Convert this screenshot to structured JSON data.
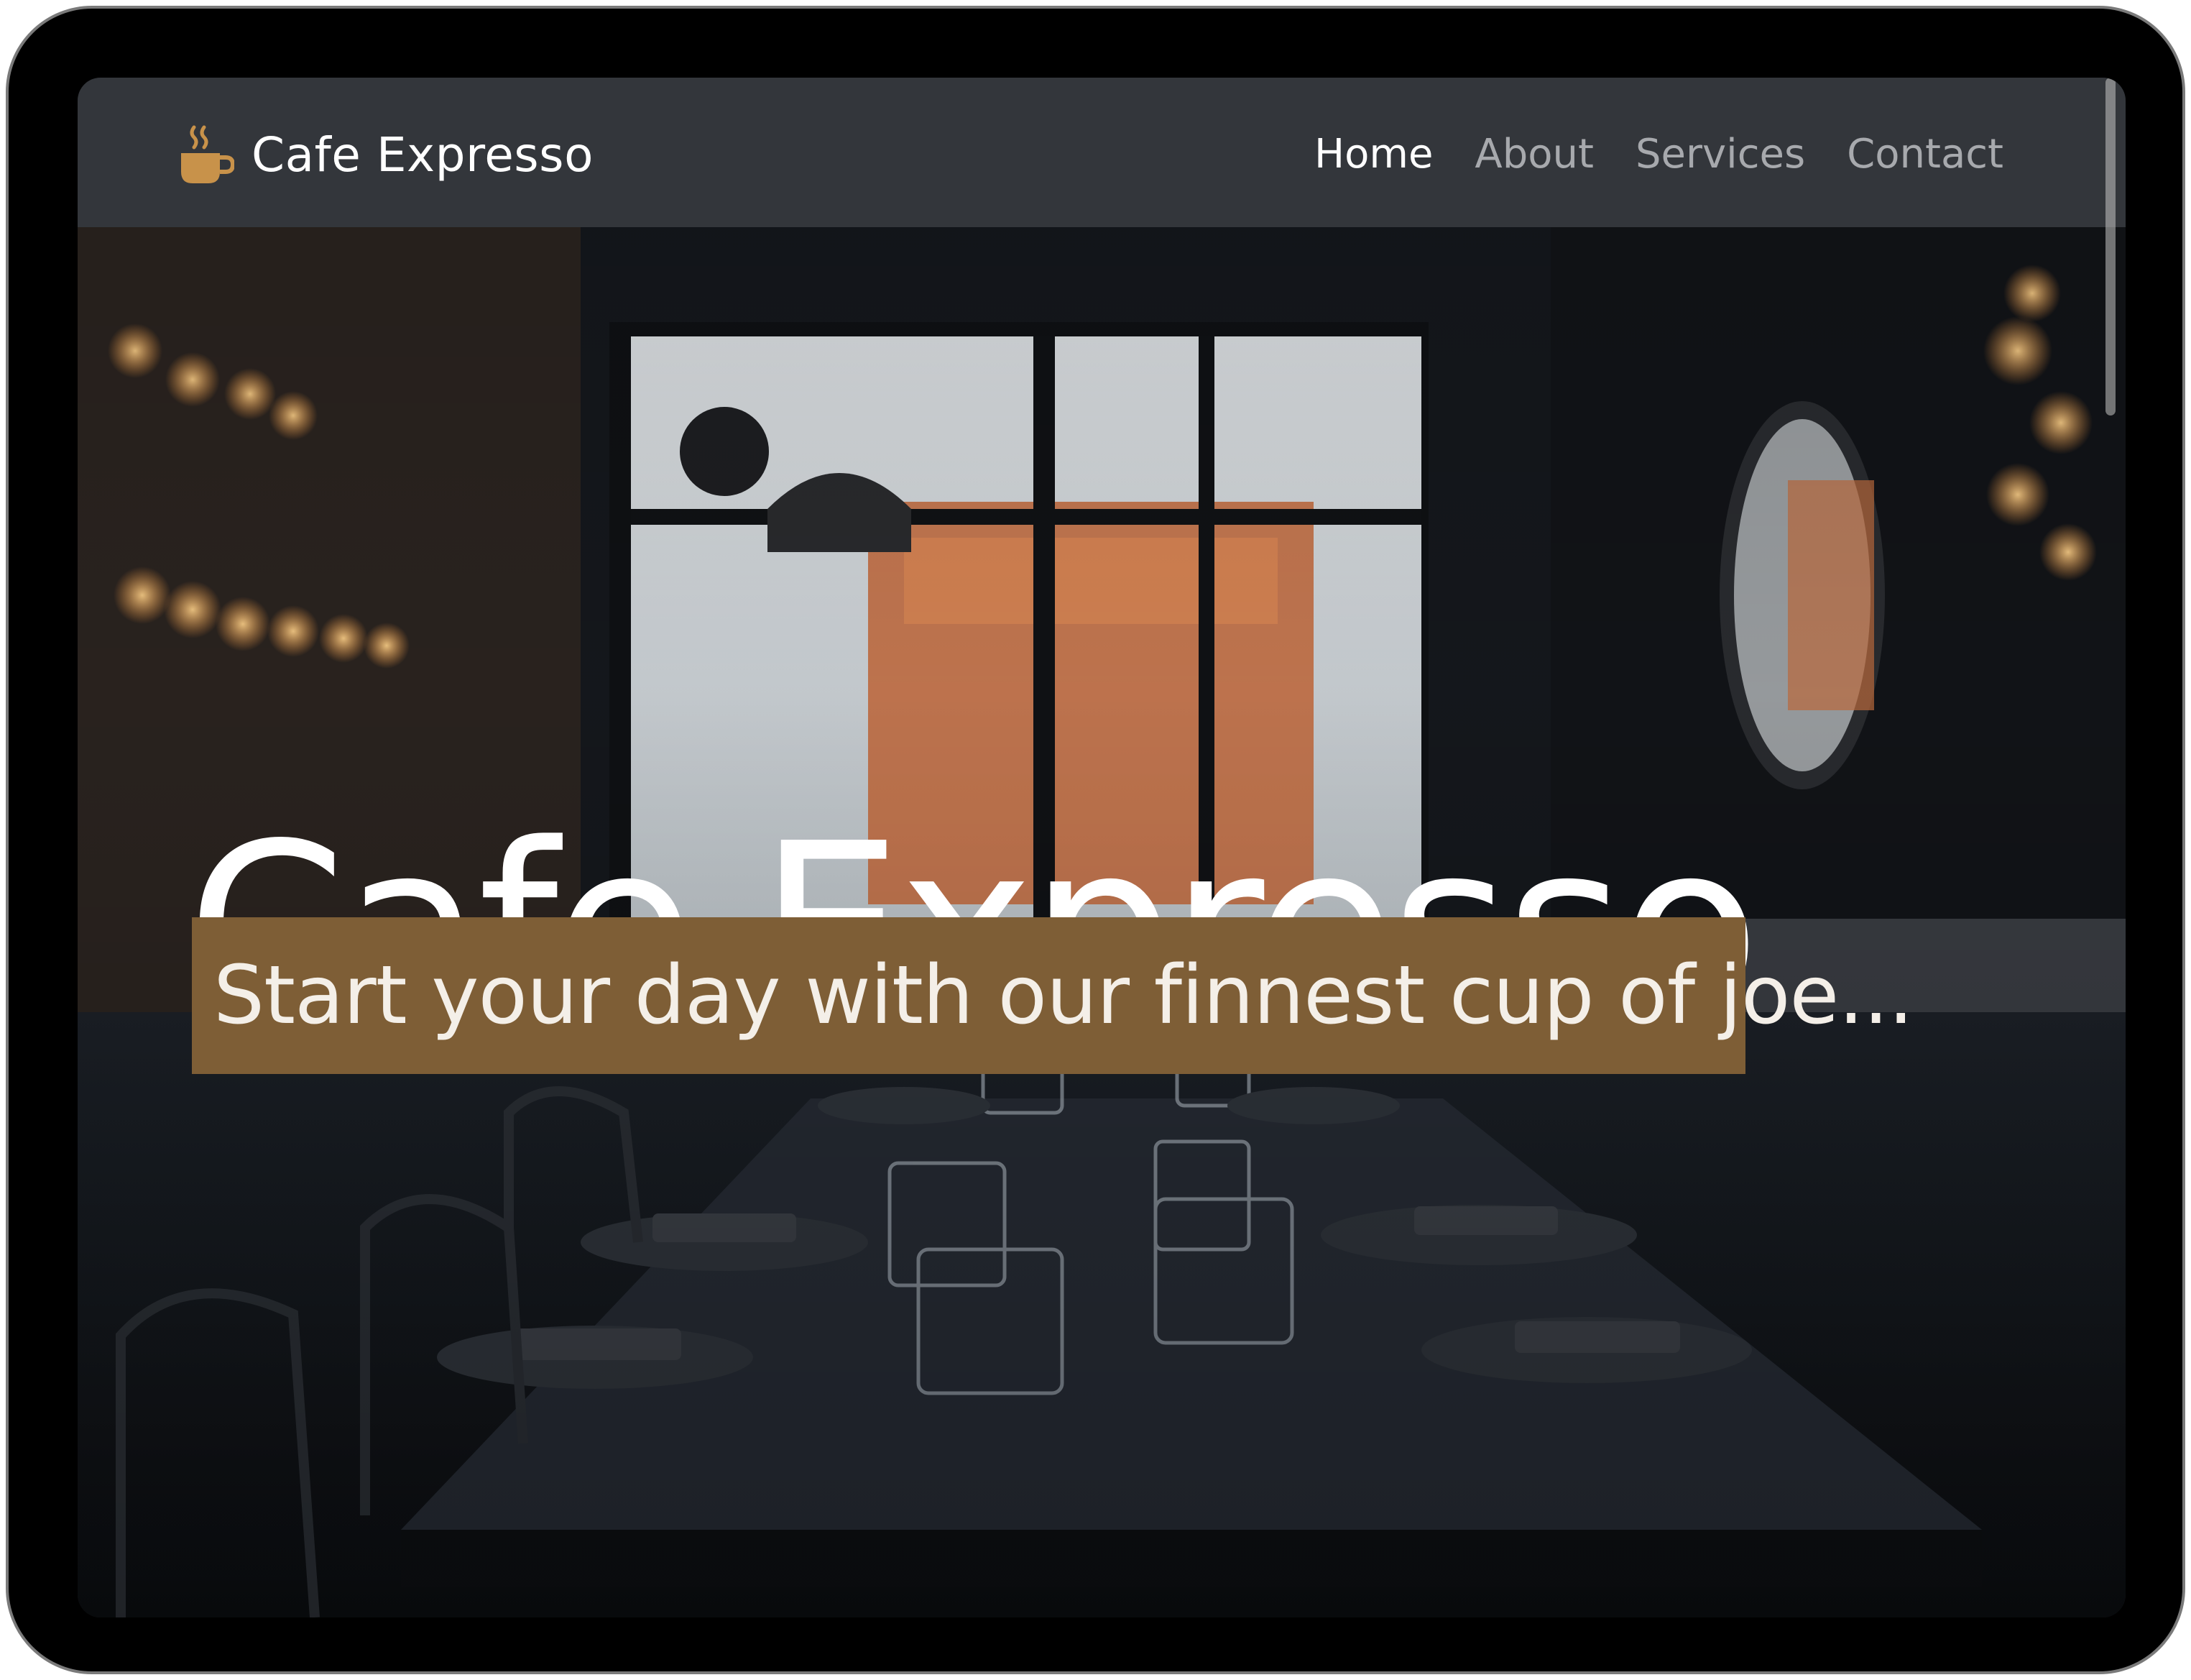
{
  "brand": {
    "name": "Cafe Expresso",
    "icon": "coffee-cup-icon",
    "icon_color": "#c8924a"
  },
  "nav": {
    "items": [
      {
        "label": "Home",
        "active": true
      },
      {
        "label": "About",
        "active": false
      },
      {
        "label": "Services",
        "active": false
      },
      {
        "label": "Contact",
        "active": false
      }
    ]
  },
  "hero": {
    "title": "Cafe Expresso",
    "subtitle": "Start your day with our finnest cup of joe...",
    "subtitle_bg": "#7e5e36"
  },
  "colors": {
    "navbar_bg": "#33363b",
    "nav_active": "#ffffff",
    "nav_inactive": "#a7a9ad"
  }
}
